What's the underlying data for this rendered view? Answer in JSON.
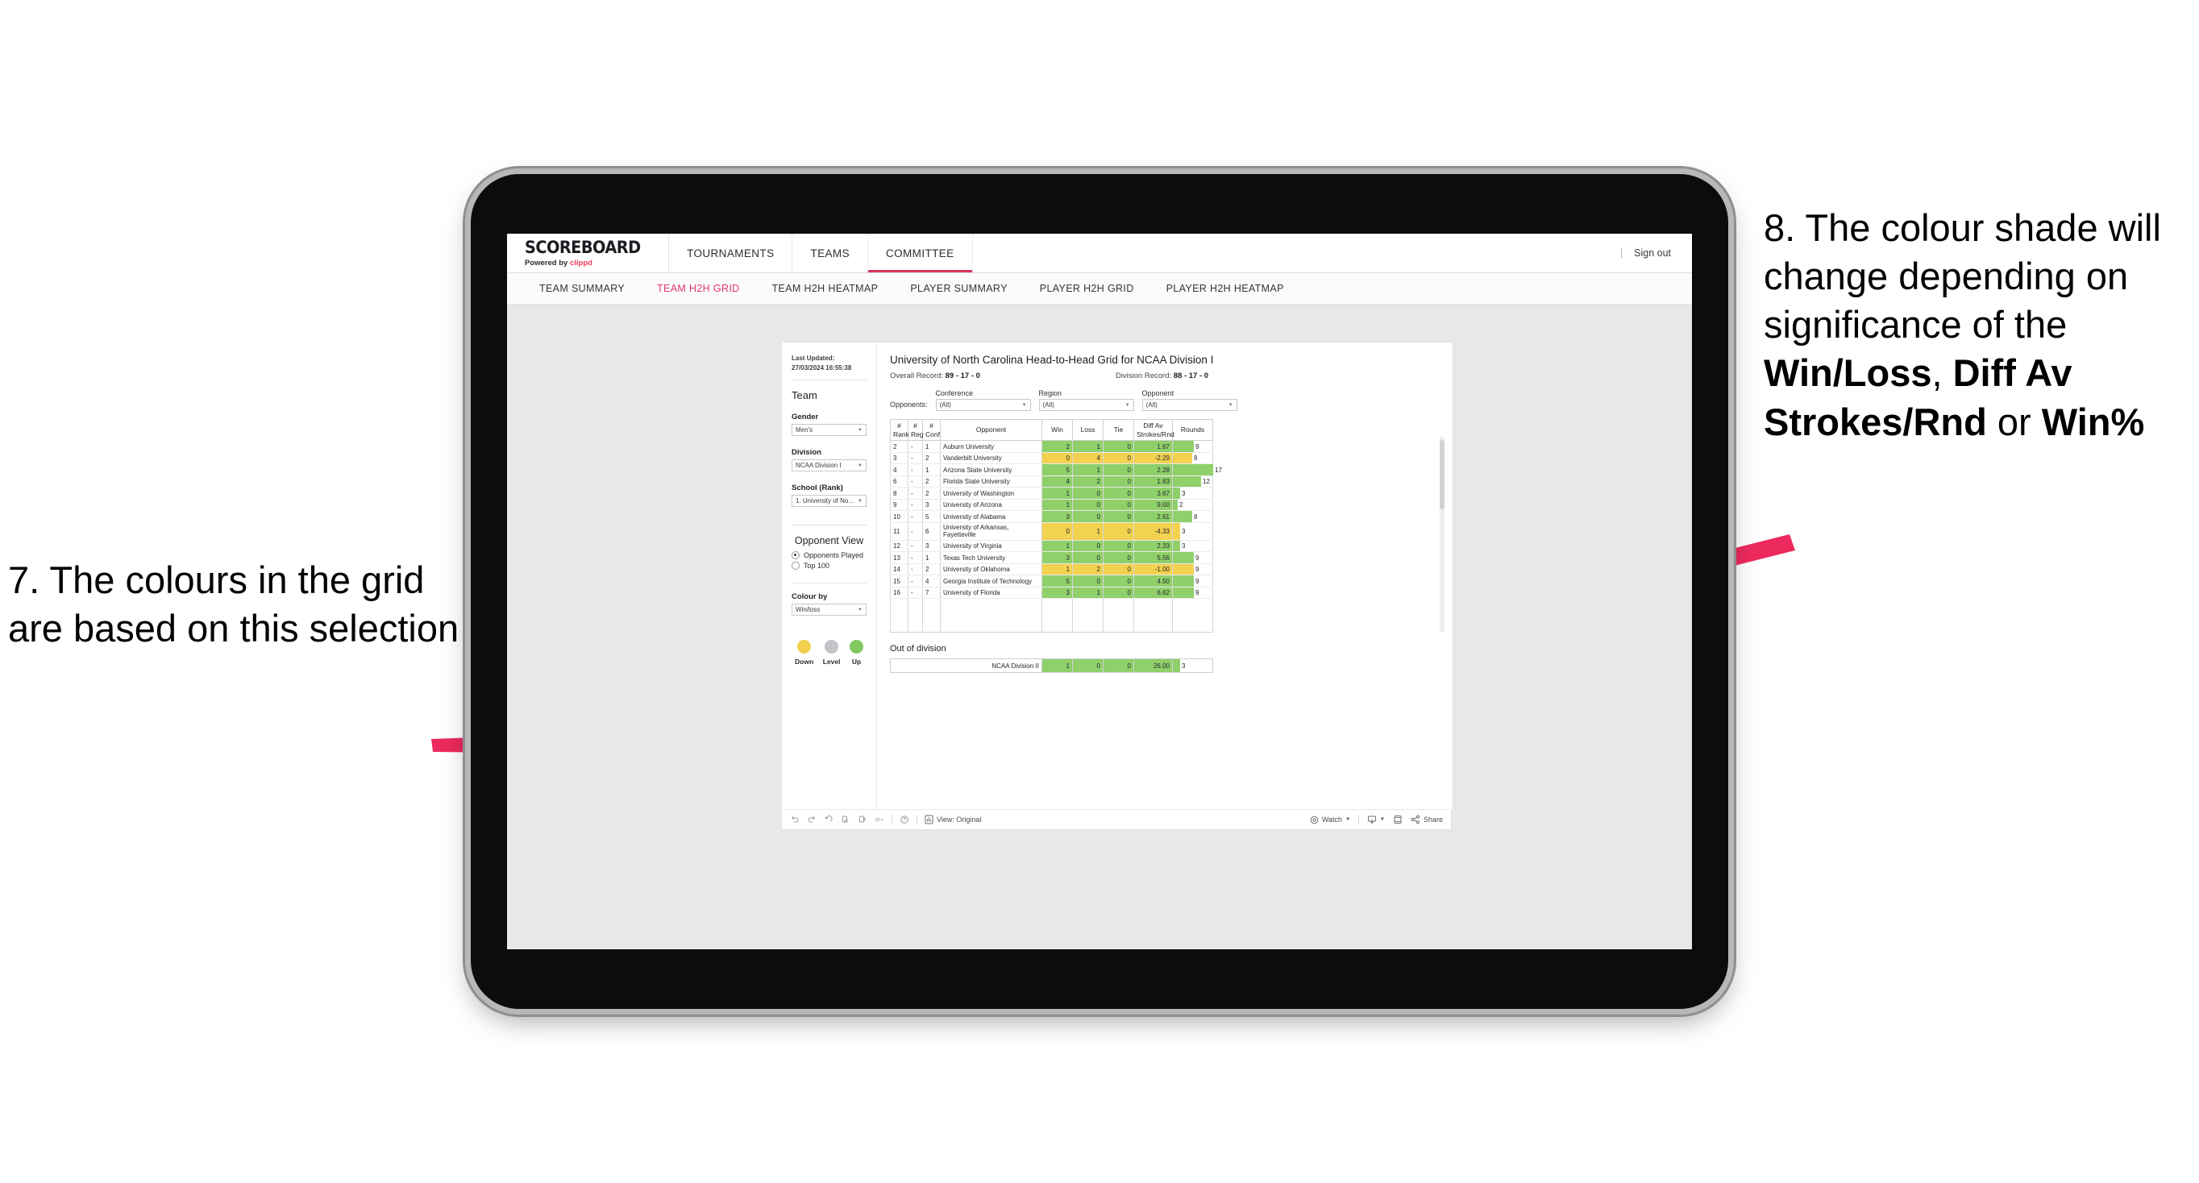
{
  "annotations": {
    "left": {
      "id": "7.",
      "text": "7. The colours in the grid are based on this selection"
    },
    "right": {
      "prefix": "8. The colour shade will change depending on significance of the ",
      "bold1": "Win/Loss",
      "mid1": ", ",
      "bold2": "Diff Av Strokes/Rnd",
      "mid2": " or ",
      "bold3": "Win%"
    },
    "arrow_color": "#ec2a5e"
  },
  "app": {
    "logo": {
      "main": "SCOREBOARD",
      "sub_prefix": "Powered by ",
      "brand": "clippd"
    },
    "topnav": [
      {
        "label": "TOURNAMENTS",
        "active": false
      },
      {
        "label": "TEAMS",
        "active": false
      },
      {
        "label": "COMMITTEE",
        "active": true
      }
    ],
    "sign_out": "Sign out",
    "subnav": [
      {
        "label": "TEAM SUMMARY",
        "active": false
      },
      {
        "label": "TEAM H2H GRID",
        "active": true
      },
      {
        "label": "TEAM H2H HEATMAP",
        "active": false
      },
      {
        "label": "PLAYER SUMMARY",
        "active": false
      },
      {
        "label": "PLAYER H2H GRID",
        "active": false
      },
      {
        "label": "PLAYER H2H HEATMAP",
        "active": false
      }
    ]
  },
  "sidebar": {
    "last_updated": "Last Updated: 27/03/2024 16:55:38",
    "team_heading": "Team",
    "gender": {
      "label": "Gender",
      "value": "Men's"
    },
    "division": {
      "label": "Division",
      "value": "NCAA Division I"
    },
    "school": {
      "label": "School (Rank)",
      "value": "1. University of Nort..."
    },
    "opponent_view": {
      "heading": "Opponent View",
      "options": [
        {
          "label": "Opponents Played",
          "selected": true
        },
        {
          "label": "Top 100",
          "selected": false
        }
      ]
    },
    "colour_by": {
      "label": "Colour by",
      "value": "Win/loss"
    },
    "legend": [
      {
        "label": "Down",
        "color": "#f0d04e"
      },
      {
        "label": "Level",
        "color": "#c3c3c8"
      },
      {
        "label": "Up",
        "color": "#7fc95f"
      }
    ]
  },
  "viz": {
    "title": "University of North Carolina Head-to-Head Grid for NCAA Division I",
    "overall_record_label": "Overall Record: ",
    "overall_record": "89 - 17 - 0",
    "division_record_label": "Division Record: ",
    "division_record": "88 - 17 - 0",
    "opponents_label": "Opponents:",
    "filters": [
      {
        "label": "Conference",
        "value": "(All)"
      },
      {
        "label": "Region",
        "value": "(All)"
      },
      {
        "label": "Opponent",
        "value": "(All)"
      }
    ],
    "out_of_division_heading": "Out of division"
  },
  "chart_data": {
    "type": "table",
    "title": "University of North Carolina Head-to-Head Grid for NCAA Division I",
    "columns": [
      "# Rank",
      "# Reg",
      "# Conf",
      "Opponent",
      "Win",
      "Loss",
      "Tie",
      "Diff Av Strokes/Rnd",
      "Rounds"
    ],
    "column_headers_two_line": [
      [
        "#",
        "Rank"
      ],
      [
        "#",
        "Reg"
      ],
      [
        "#",
        "Conf"
      ],
      [
        "",
        "Opponent"
      ],
      [
        "",
        "Win"
      ],
      [
        "",
        "Loss"
      ],
      [
        "",
        "Tie"
      ],
      [
        "Diff Av",
        "Strokes/Rnd"
      ],
      [
        "",
        "Rounds"
      ]
    ],
    "rounds_max": 17,
    "colors": {
      "up": "#8fd06a",
      "down": "#f2d24f",
      "level": "#c3c3c8"
    },
    "rows": [
      {
        "rank": "2",
        "reg": "-",
        "conf": "1",
        "opponent": "Auburn University",
        "win": "2",
        "loss": "1",
        "tie": "0",
        "diff": "1.67",
        "rounds": 9,
        "state": "up"
      },
      {
        "rank": "3",
        "reg": "-",
        "conf": "2",
        "opponent": "Vanderbilt University",
        "win": "0",
        "loss": "4",
        "tie": "0",
        "diff": "-2.29",
        "rounds": 8,
        "state": "down"
      },
      {
        "rank": "4",
        "reg": "-",
        "conf": "1",
        "opponent": "Arizona State University",
        "win": "5",
        "loss": "1",
        "tie": "0",
        "diff": "2.28",
        "rounds": 17,
        "state": "up"
      },
      {
        "rank": "6",
        "reg": "-",
        "conf": "2",
        "opponent": "Florida State University",
        "win": "4",
        "loss": "2",
        "tie": "0",
        "diff": "1.83",
        "rounds": 12,
        "state": "up"
      },
      {
        "rank": "8",
        "reg": "-",
        "conf": "2",
        "opponent": "University of Washington",
        "win": "1",
        "loss": "0",
        "tie": "0",
        "diff": "3.67",
        "rounds": 3,
        "state": "up"
      },
      {
        "rank": "9",
        "reg": "-",
        "conf": "3",
        "opponent": "University of Arizona",
        "win": "1",
        "loss": "0",
        "tie": "0",
        "diff": "9.00",
        "rounds": 2,
        "state": "up"
      },
      {
        "rank": "10",
        "reg": "-",
        "conf": "5",
        "opponent": "University of Alabama",
        "win": "3",
        "loss": "0",
        "tie": "0",
        "diff": "2.61",
        "rounds": 8,
        "state": "up"
      },
      {
        "rank": "11",
        "reg": "-",
        "conf": "6",
        "opponent": "University of Arkansas, Fayetteville",
        "win": "0",
        "loss": "1",
        "tie": "0",
        "diff": "-4.33",
        "rounds": 3,
        "state": "down"
      },
      {
        "rank": "12",
        "reg": "-",
        "conf": "3",
        "opponent": "University of Virginia",
        "win": "1",
        "loss": "0",
        "tie": "0",
        "diff": "2.33",
        "rounds": 3,
        "state": "up"
      },
      {
        "rank": "13",
        "reg": "-",
        "conf": "1",
        "opponent": "Texas Tech University",
        "win": "3",
        "loss": "0",
        "tie": "0",
        "diff": "5.56",
        "rounds": 9,
        "state": "up"
      },
      {
        "rank": "14",
        "reg": "-",
        "conf": "2",
        "opponent": "University of Oklahoma",
        "win": "1",
        "loss": "2",
        "tie": "0",
        "diff": "-1.00",
        "rounds": 9,
        "state": "down"
      },
      {
        "rank": "15",
        "reg": "-",
        "conf": "4",
        "opponent": "Georgia Institute of Technology",
        "win": "5",
        "loss": "0",
        "tie": "0",
        "diff": "4.50",
        "rounds": 9,
        "state": "up"
      },
      {
        "rank": "16",
        "reg": "-",
        "conf": "7",
        "opponent": "University of Florida",
        "win": "3",
        "loss": "1",
        "tie": "0",
        "diff": "6.62",
        "rounds": 9,
        "state": "up"
      }
    ],
    "out_of_division": [
      {
        "opponent": "NCAA Division II",
        "win": "1",
        "loss": "0",
        "tie": "0",
        "diff": "26.00",
        "rounds": 3,
        "state": "up"
      }
    ]
  },
  "toolbar": {
    "view_label": "View: Original",
    "watch_label": "Watch",
    "share_label": "Share"
  }
}
